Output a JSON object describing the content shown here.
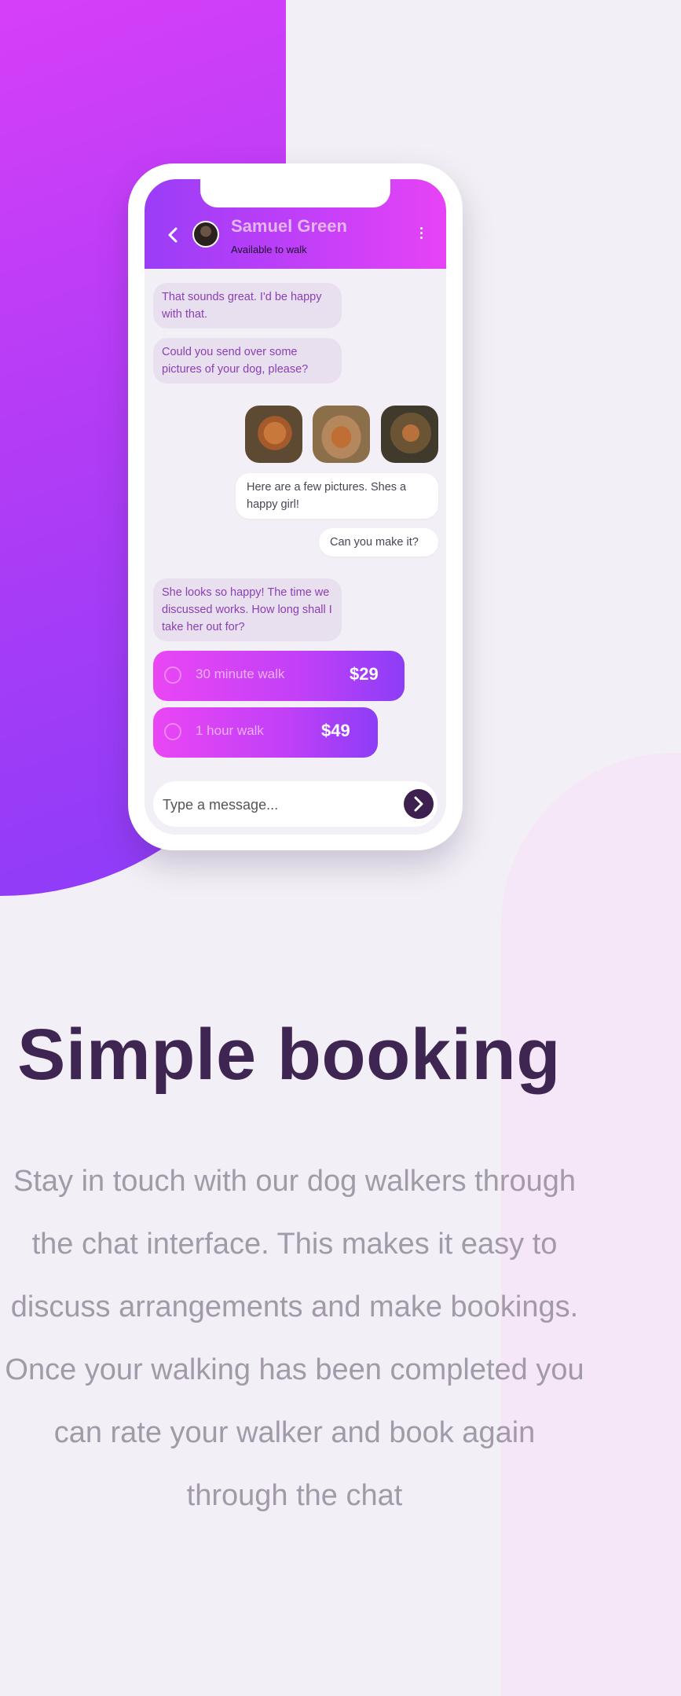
{
  "chat": {
    "contact_name": "Samuel Green",
    "contact_status": "Available to walk",
    "messages": [
      "That sounds great. I'd be happy with that.",
      "Could you send over some pictures of your dog, please?",
      "Here are a few pictures. Shes a happy girl!",
      "Can you make it?",
      "She looks so happy! The time we discussed works. How long shall I take her out for?"
    ],
    "options": [
      {
        "label": "30 minute walk",
        "price": "$29"
      },
      {
        "label": "1 hour walk",
        "price": "$49"
      }
    ],
    "input_placeholder": "Type a message..."
  },
  "feature": {
    "title": "Simple booking",
    "description": "Stay in touch with our dog walkers through the chat interface. This makes it easy to discuss arrangements and make bookings. Once your walking has been completed you can rate your walker and book again through the chat"
  },
  "colors": {
    "header_start": "#9a3df7",
    "header_end": "#e743f6",
    "title": "#3f2652",
    "body_text": "#a29aa9",
    "send_button": "#3e2050"
  }
}
